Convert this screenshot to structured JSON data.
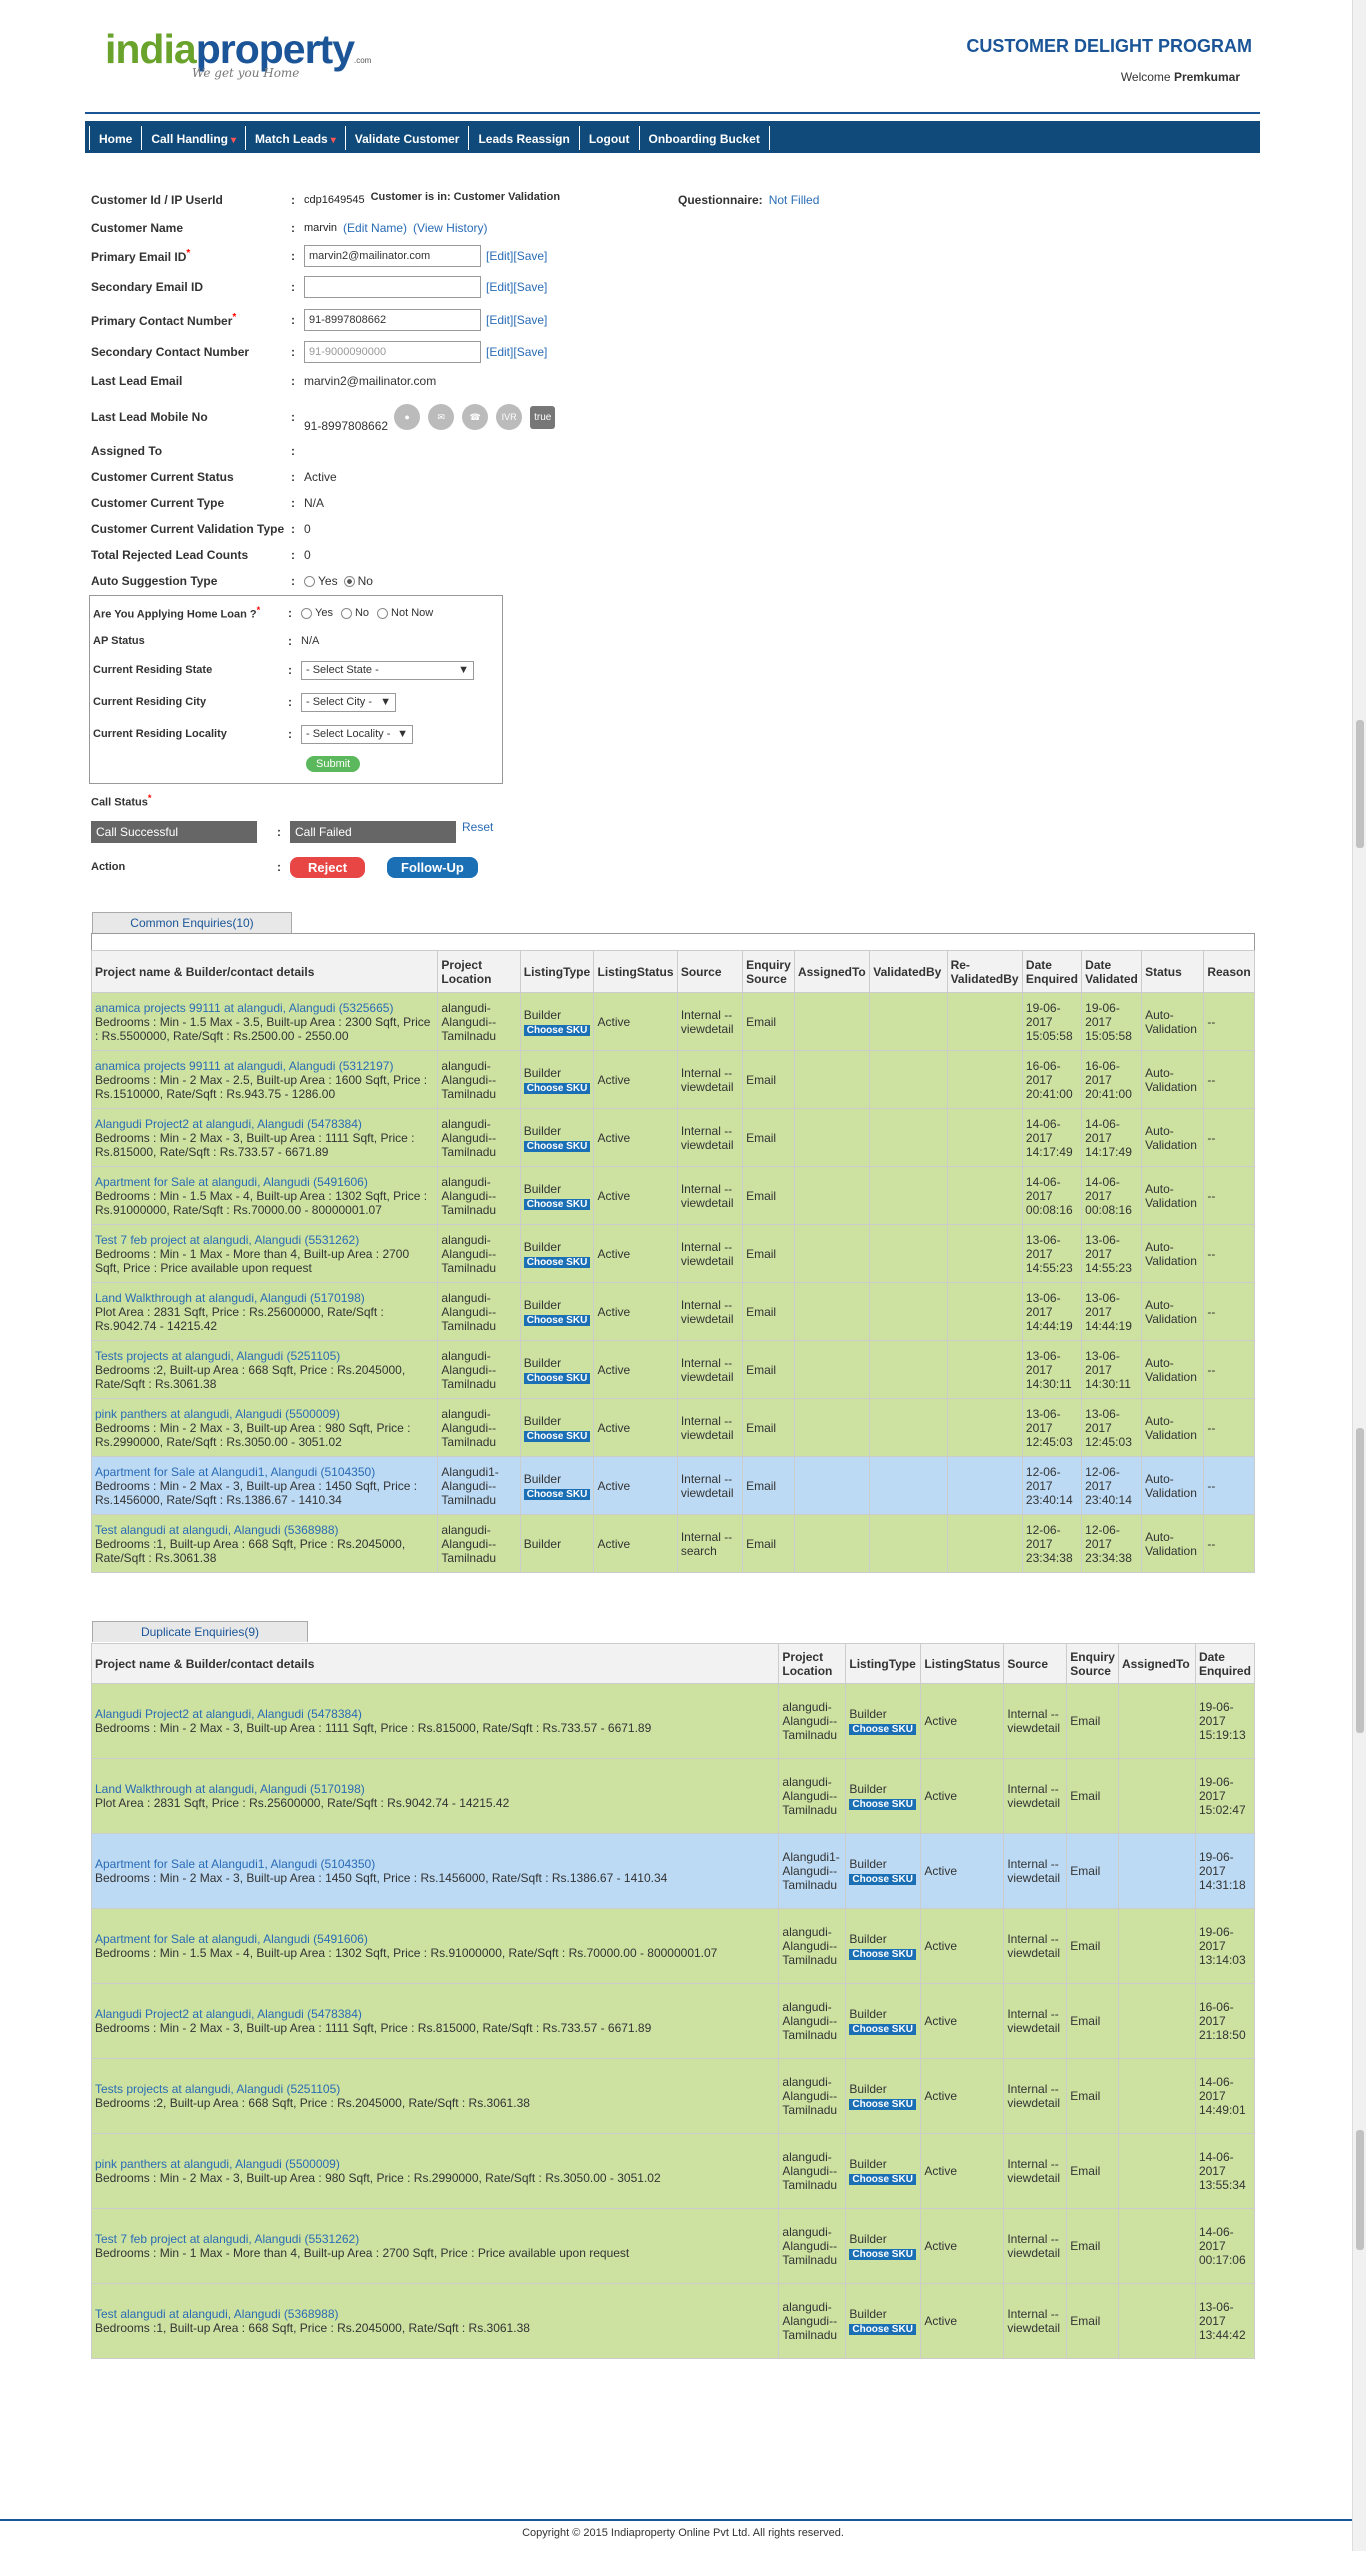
{
  "logo": {
    "part1": "india",
    "part2": "property",
    "com": ".com",
    "tagline": "We get you Home"
  },
  "header": {
    "program": "CUSTOMER DELIGHT PROGRAM",
    "welcome": "Welcome",
    "user": "Premkumar"
  },
  "nav": [
    {
      "label": "Home"
    },
    {
      "label": "Call Handling",
      "caret": "▾"
    },
    {
      "label": "Match Leads",
      "caret": "▾"
    },
    {
      "label": "Validate Customer"
    },
    {
      "label": "Leads Reassign"
    },
    {
      "label": "Logout"
    },
    {
      "label": "Onboarding Bucket"
    }
  ],
  "customer": {
    "id_label": "Customer Id / IP UserId",
    "id_value": "cdp1649545",
    "status_in": "Customer is in: Customer Validation",
    "questionnaire_label": "Questionnaire:",
    "questionnaire_value": "Not Filled",
    "name_label": "Customer Name",
    "name_value": "marvin",
    "edit_name": "(Edit Name)",
    "view_history": "(View History)",
    "primary_email_label": "Primary Email ID",
    "primary_email_value": "marvin2@mailinator.com",
    "secondary_email_label": "Secondary Email ID",
    "secondary_email_value": "",
    "primary_contact_label": "Primary Contact Number",
    "primary_contact_value": "91-8997808662",
    "secondary_contact_label": "Secondary Contact Number",
    "secondary_contact_placeholder": "91-9000090000",
    "edit": "[Edit]",
    "save": "[Save]",
    "last_email_label": "Last Lead Email",
    "last_email_value": "marvin2@mailinator.com",
    "last_mobile_label": "Last Lead Mobile No",
    "last_mobile_value": "91-8997808662",
    "true_label": "true",
    "assigned_label": "Assigned To",
    "assigned_value": "",
    "status_label": "Customer Current Status",
    "status_value": "Active",
    "type_label": "Customer Current Type",
    "type_value": "N/A",
    "validation_type_label": "Customer Current Validation Type",
    "validation_type_value": "0",
    "rejected_label": "Total Rejected Lead Counts",
    "rejected_value": "0",
    "auto_label": "Auto Suggestion Type",
    "auto_yes": "Yes",
    "auto_no": "No"
  },
  "homeloan": {
    "label": "Are You Applying Home Loan ?",
    "opt_yes": "Yes",
    "opt_no": "No",
    "opt_notnow": "Not Now",
    "ap_label": "AP Status",
    "ap_value": "N/A",
    "state_label": "Current Residing State",
    "state_value": "- Select State -",
    "city_label": "Current Residing City",
    "city_value": "- Select City -",
    "locality_label": "Current Residing Locality",
    "locality_value": "- Select Locality -",
    "submit": "Submit"
  },
  "call": {
    "status_label": "Call Status",
    "success": "Call Successful",
    "failed": "Call Failed",
    "reset": "Reset",
    "action_label": "Action",
    "reject": "Reject",
    "followup": "Follow-Up"
  },
  "common": {
    "tab": "Common Enquiries(10)",
    "headers": [
      "Project name & Builder/contact details",
      "Project Location",
      "ListingType",
      "ListingStatus",
      "Source",
      "Enquiry Source",
      "AssignedTo",
      "ValidatedBy",
      "Re-ValidatedBy",
      "Date Enquired",
      "Date Validated",
      "Status",
      "Reason"
    ],
    "rows": [
      {
        "hl": "g",
        "name": "anamica projects 99111 at alangudi, Alangudi (5325665)",
        "details": "Bedrooms : Min - 1.5 Max - 3.5, Built-up Area : 2300 Sqft, Price : Rs.5500000, Rate/Sqft : Rs.2500.00 - 2550.00",
        "loc": "alangudi-Alangudi--Tamilnadu",
        "type": "Builder",
        "sku": "Choose SKU",
        "status": "Active",
        "source": "Internal -- viewdetail",
        "esource": "Email",
        "assigned": "",
        "validated": "",
        "revalidated": "",
        "denq": "19-06-2017 15:05:58",
        "dval": "19-06-2017 15:05:58",
        "st": "Auto-Validation",
        "reason": "--"
      },
      {
        "hl": "g",
        "name": "anamica projects 99111 at alangudi, Alangudi (5312197)",
        "details": "Bedrooms : Min - 2 Max - 2.5, Built-up Area : 1600 Sqft, Price : Rs.1510000, Rate/Sqft : Rs.943.75 - 1286.00",
        "loc": "alangudi-Alangudi--Tamilnadu",
        "type": "Builder",
        "sku": "Choose SKU",
        "status": "Active",
        "source": "Internal -- viewdetail",
        "esource": "Email",
        "assigned": "",
        "validated": "",
        "revalidated": "",
        "denq": "16-06-2017 20:41:00",
        "dval": "16-06-2017 20:41:00",
        "st": "Auto-Validation",
        "reason": "--"
      },
      {
        "hl": "g",
        "name": "Alangudi Project2 at alangudi, Alangudi (5478384)",
        "details": "Bedrooms : Min - 2 Max - 3, Built-up Area : 1111 Sqft, Price : Rs.815000, Rate/Sqft : Rs.733.57 - 6671.89",
        "loc": "alangudi-Alangudi--Tamilnadu",
        "type": "Builder",
        "sku": "Choose SKU",
        "status": "Active",
        "source": "Internal -- viewdetail",
        "esource": "Email",
        "assigned": "",
        "validated": "",
        "revalidated": "",
        "denq": "14-06-2017 14:17:49",
        "dval": "14-06-2017 14:17:49",
        "st": "Auto-Validation",
        "reason": "--"
      },
      {
        "hl": "g",
        "name": "Apartment for Sale at alangudi, Alangudi (5491606)",
        "details": "Bedrooms : Min - 1.5 Max - 4, Built-up Area : 1302 Sqft, Price : Rs.91000000, Rate/Sqft : Rs.70000.00 - 80000001.07",
        "loc": "alangudi-Alangudi--Tamilnadu",
        "type": "Builder",
        "sku": "Choose SKU",
        "status": "Active",
        "source": "Internal -- viewdetail",
        "esource": "Email",
        "assigned": "",
        "validated": "",
        "revalidated": "",
        "denq": "14-06-2017 00:08:16",
        "dval": "14-06-2017 00:08:16",
        "st": "Auto-Validation",
        "reason": "--"
      },
      {
        "hl": "g",
        "name": "Test 7 feb project at alangudi, Alangudi (5531262)",
        "details": "Bedrooms : Min - 1 Max - More than 4, Built-up Area : 2700 Sqft, Price : Price available upon request",
        "loc": "alangudi-Alangudi--Tamilnadu",
        "type": "Builder",
        "sku": "Choose SKU",
        "status": "Active",
        "source": "Internal -- viewdetail",
        "esource": "Email",
        "assigned": "",
        "validated": "",
        "revalidated": "",
        "denq": "13-06-2017 14:55:23",
        "dval": "13-06-2017 14:55:23",
        "st": "Auto-Validation",
        "reason": "--"
      },
      {
        "hl": "g",
        "name": "Land Walkthrough at alangudi, Alangudi (5170198)",
        "details": "Plot Area : 2831 Sqft, Price : Rs.25600000, Rate/Sqft : Rs.9042.74 - 14215.42",
        "loc": "alangudi-Alangudi--Tamilnadu",
        "type": "Builder",
        "sku": "Choose SKU",
        "status": "Active",
        "source": "Internal -- viewdetail",
        "esource": "Email",
        "assigned": "",
        "validated": "",
        "revalidated": "",
        "denq": "13-06-2017 14:44:19",
        "dval": "13-06-2017 14:44:19",
        "st": "Auto-Validation",
        "reason": "--"
      },
      {
        "hl": "g",
        "name": "Tests projects at alangudi, Alangudi (5251105)",
        "details": "Bedrooms :2, Built-up Area : 668 Sqft, Price : Rs.2045000, Rate/Sqft : Rs.3061.38",
        "loc": "alangudi-Alangudi--Tamilnadu",
        "type": "Builder",
        "sku": "Choose SKU",
        "status": "Active",
        "source": "Internal -- viewdetail",
        "esource": "Email",
        "assigned": "",
        "validated": "",
        "revalidated": "",
        "denq": "13-06-2017 14:30:11",
        "dval": "13-06-2017 14:30:11",
        "st": "Auto-Validation",
        "reason": "--"
      },
      {
        "hl": "g",
        "name": "pink panthers at alangudi, Alangudi (5500009)",
        "details": "Bedrooms : Min - 2 Max - 3, Built-up Area : 980 Sqft, Price : Rs.2990000, Rate/Sqft : Rs.3050.00 - 3051.02",
        "loc": "alangudi-Alangudi--Tamilnadu",
        "type": "Builder",
        "sku": "Choose SKU",
        "status": "Active",
        "source": "Internal -- viewdetail",
        "esource": "Email",
        "assigned": "",
        "validated": "",
        "revalidated": "",
        "denq": "13-06-2017 12:45:03",
        "dval": "13-06-2017 12:45:03",
        "st": "Auto-Validation",
        "reason": "--"
      },
      {
        "hl": "b",
        "name": "Apartment for Sale at Alangudi1, Alangudi (5104350)",
        "details": "Bedrooms : Min - 2 Max - 3, Built-up Area : 1450 Sqft, Price : Rs.1456000, Rate/Sqft : Rs.1386.67 - 1410.34",
        "loc": "Alangudi1-Alangudi--Tamilnadu",
        "type": "Builder",
        "sku": "Choose SKU",
        "status": "Active",
        "source": "Internal -- viewdetail",
        "esource": "Email",
        "assigned": "",
        "validated": "",
        "revalidated": "",
        "denq": "12-06-2017 23:40:14",
        "dval": "12-06-2017 23:40:14",
        "st": "Auto-Validation",
        "reason": "--"
      },
      {
        "hl": "g",
        "name": "Test alangudi at alangudi, Alangudi (5368988)",
        "details": "Bedrooms :1, Built-up Area : 668 Sqft, Price : Rs.2045000, Rate/Sqft : Rs.3061.38",
        "loc": "alangudi-Alangudi--Tamilnadu",
        "type": "Builder",
        "sku": "",
        "status": "Active",
        "source": "Internal -- search",
        "esource": "Email",
        "assigned": "",
        "validated": "",
        "revalidated": "",
        "denq": "12-06-2017 23:34:38",
        "dval": "12-06-2017 23:34:38",
        "st": "Auto-Validation",
        "reason": "--"
      }
    ]
  },
  "duplicate": {
    "tab": "Duplicate Enquiries(9)",
    "headers": [
      "Project name & Builder/contact details",
      "Project Location",
      "ListingType",
      "ListingStatus",
      "Source",
      "Enquiry Source",
      "AssignedTo",
      "Date Enquired"
    ],
    "rows": [
      {
        "hl": "g",
        "name": "Alangudi Project2 at alangudi, Alangudi (5478384)",
        "details": "Bedrooms : Min - 2 Max - 3, Built-up Area : 1111 Sqft, Price : Rs.815000, Rate/Sqft : Rs.733.57 - 6671.89",
        "loc": "alangudi-Alangudi--Tamilnadu",
        "type": "Builder",
        "sku": "Choose SKU",
        "status": "Active",
        "source": "Internal -- viewdetail",
        "esource": "Email",
        "assigned": "",
        "denq": "19-06-2017 15:19:13"
      },
      {
        "hl": "g",
        "name": "Land Walkthrough at alangudi, Alangudi (5170198)",
        "details": "Plot Area : 2831 Sqft, Price : Rs.25600000, Rate/Sqft : Rs.9042.74 - 14215.42",
        "loc": "alangudi-Alangudi--Tamilnadu",
        "type": "Builder",
        "sku": "Choose SKU",
        "status": "Active",
        "source": "Internal -- viewdetail",
        "esource": "Email",
        "assigned": "",
        "denq": "19-06-2017 15:02:47"
      },
      {
        "hl": "b",
        "name": "Apartment for Sale at Alangudi1, Alangudi (5104350)",
        "details": "Bedrooms : Min - 2 Max - 3, Built-up Area : 1450 Sqft, Price : Rs.1456000, Rate/Sqft : Rs.1386.67 - 1410.34",
        "loc": "Alangudi1-Alangudi--Tamilnadu",
        "type": "Builder",
        "sku": "Choose SKU",
        "status": "Active",
        "source": "Internal -- viewdetail",
        "esource": "Email",
        "assigned": "",
        "denq": "19-06-2017 14:31:18"
      },
      {
        "hl": "g",
        "name": "Apartment for Sale at alangudi, Alangudi (5491606)",
        "details": "Bedrooms : Min - 1.5 Max - 4, Built-up Area : 1302 Sqft, Price : Rs.91000000, Rate/Sqft : Rs.70000.00 - 80000001.07",
        "loc": "alangudi-Alangudi--Tamilnadu",
        "type": "Builder",
        "sku": "Choose SKU",
        "status": "Active",
        "source": "Internal -- viewdetail",
        "esource": "Email",
        "assigned": "",
        "denq": "19-06-2017 13:14:03"
      },
      {
        "hl": "g",
        "name": "Alangudi Project2 at alangudi, Alangudi (5478384)",
        "details": "Bedrooms : Min - 2 Max - 3, Built-up Area : 1111 Sqft, Price : Rs.815000, Rate/Sqft : Rs.733.57 - 6671.89",
        "loc": "alangudi-Alangudi--Tamilnadu",
        "type": "Builder",
        "sku": "Choose SKU",
        "status": "Active",
        "source": "Internal -- viewdetail",
        "esource": "Email",
        "assigned": "",
        "denq": "16-06-2017 21:18:50"
      },
      {
        "hl": "g",
        "name": "Tests projects at alangudi, Alangudi (5251105)",
        "details": "Bedrooms :2, Built-up Area : 668 Sqft, Price : Rs.2045000, Rate/Sqft : Rs.3061.38",
        "loc": "alangudi-Alangudi--Tamilnadu",
        "type": "Builder",
        "sku": "Choose SKU",
        "status": "Active",
        "source": "Internal -- viewdetail",
        "esource": "Email",
        "assigned": "",
        "denq": "14-06-2017 14:49:01"
      },
      {
        "hl": "g",
        "name": "pink panthers at alangudi, Alangudi (5500009)",
        "details": "Bedrooms : Min - 2 Max - 3, Built-up Area : 980 Sqft, Price : Rs.2990000, Rate/Sqft : Rs.3050.00 - 3051.02",
        "loc": "alangudi-Alangudi--Tamilnadu",
        "type": "Builder",
        "sku": "Choose SKU",
        "status": "Active",
        "source": "Internal -- viewdetail",
        "esource": "Email",
        "assigned": "",
        "denq": "14-06-2017 13:55:34"
      },
      {
        "hl": "g",
        "name": "Test 7 feb project at alangudi, Alangudi (5531262)",
        "details": "Bedrooms : Min - 1 Max - More than 4, Built-up Area : 2700 Sqft, Price : Price available upon request",
        "loc": "alangudi-Alangudi--Tamilnadu",
        "type": "Builder",
        "sku": "Choose SKU",
        "status": "Active",
        "source": "Internal -- viewdetail",
        "esource": "Email",
        "assigned": "",
        "denq": "14-06-2017 00:17:06"
      },
      {
        "hl": "g",
        "name": "Test alangudi at alangudi, Alangudi (5368988)",
        "details": "Bedrooms :1, Built-up Area : 668 Sqft, Price : Rs.2045000, Rate/Sqft : Rs.3061.38",
        "loc": "alangudi-Alangudi--Tamilnadu",
        "type": "Builder",
        "sku": "Choose SKU",
        "status": "Active",
        "source": "Internal -- viewdetail",
        "esource": "Email",
        "assigned": "",
        "denq": "13-06-2017 13:44:42"
      }
    ]
  },
  "footer": {
    "text": "Copyright © 2015 Indiaproperty Online Pvt Ltd. All rights reserved."
  }
}
